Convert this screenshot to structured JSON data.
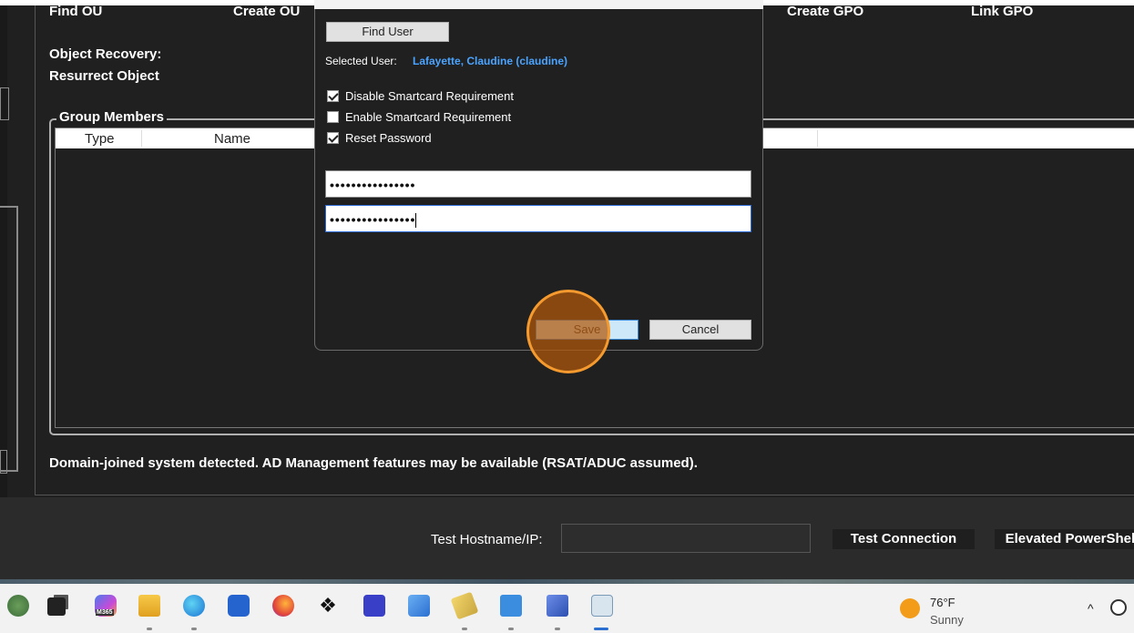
{
  "actions": {
    "find_ou": "Find OU",
    "create_ou": "Create OU",
    "create_gpo": "Create GPO",
    "link_gpo": "Link GPO",
    "object_recovery": "Object Recovery:",
    "resurrect_object": "Resurrect Object"
  },
  "group_members": {
    "legend": "Group Members",
    "columns": [
      "Type",
      "Name"
    ]
  },
  "status": "Domain-joined system detected. AD Management features may be available (RSAT/ADUC assumed).",
  "bottom": {
    "test_label": "Test Hostname/IP:",
    "test_value": "",
    "test_connection": "Test Connection",
    "elevated_powershell": "Elevated PowerShell"
  },
  "dialog": {
    "find_user": "Find User",
    "selected_user_label": "Selected User:",
    "selected_user_value": "Lafayette, Claudine (claudine)",
    "options": [
      {
        "label": "Disable Smartcard Requirement",
        "checked": true
      },
      {
        "label": "Enable Smartcard Requirement",
        "checked": false
      },
      {
        "label": "Reset Password",
        "checked": true
      }
    ],
    "password": "••••••••••••••••",
    "confirm_password": "••••••••••••••••",
    "save": "Save",
    "cancel": "Cancel"
  },
  "taskbar": {
    "m365_badge": "M365",
    "weather_temp": "76°F",
    "weather_cond": "Sunny",
    "icons": [
      "windows-start-icon",
      "task-view-icon",
      "m365-icon",
      "file-explorer-icon",
      "edge-icon",
      "store-icon",
      "firefox-icon",
      "dropbox-icon",
      "remote-desktop-icon",
      "network-icon",
      "notes-icon",
      "notepad-icon",
      "admin-tool-icon",
      "terminal-icon"
    ]
  },
  "colors": {
    "app_bg": "#202020",
    "accent_link": "#4aa3ff",
    "click_ring": "#f59a2e"
  }
}
